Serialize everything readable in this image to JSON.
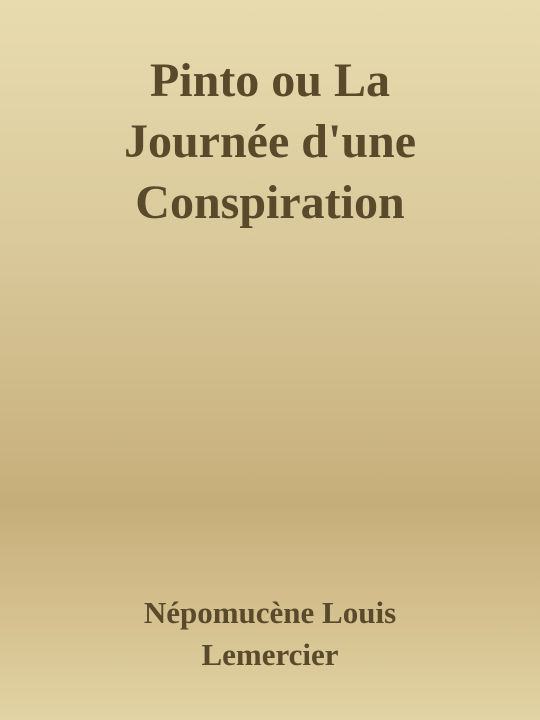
{
  "cover": {
    "title_lines": [
      "Pinto ou La",
      "Journée d'une",
      "Conspiration"
    ],
    "author_lines": [
      "Népomucène Louis",
      "Lemercier"
    ],
    "colors": {
      "background_top": "#e8dcae",
      "background_mid": "#c6ae7a",
      "text": "#5a4a2c"
    }
  }
}
